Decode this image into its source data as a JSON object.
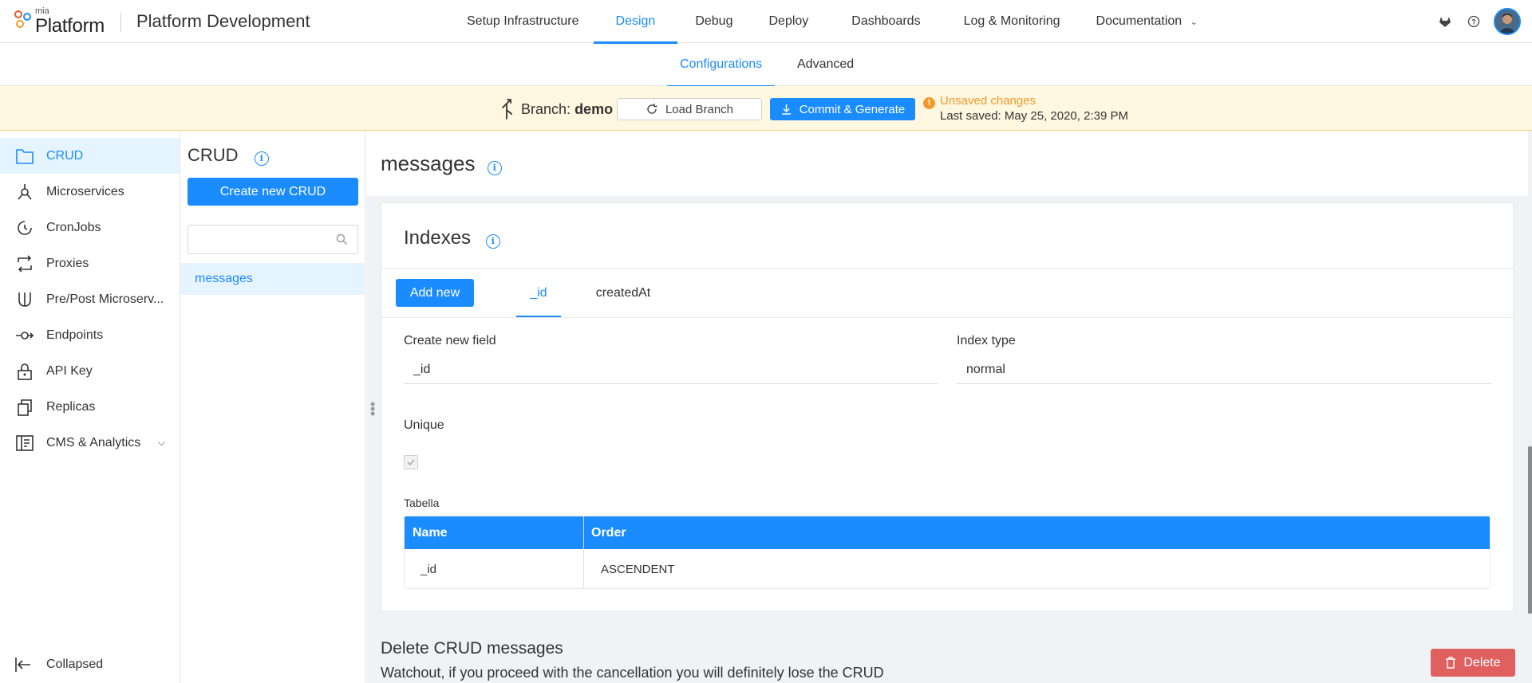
{
  "header": {
    "logo_small": "mia",
    "logo_big": "Platform",
    "app_title": "Platform Development",
    "nav": [
      {
        "label": "Setup Infrastructure"
      },
      {
        "label": "Design"
      },
      {
        "label": "Debug"
      },
      {
        "label": "Deploy"
      },
      {
        "label": "Dashboards"
      },
      {
        "label": "Log & Monitoring"
      },
      {
        "label": "Documentation"
      }
    ],
    "active_nav": "Design"
  },
  "subtabs": [
    {
      "label": "Configurations"
    },
    {
      "label": "Advanced"
    }
  ],
  "branch": {
    "label": "Branch:",
    "name": "demo",
    "load_button": "Load Branch",
    "commit_button": "Commit & Generate",
    "unsaved": "Unsaved changes",
    "last_saved": "Last saved:  May 25, 2020, 2:39 PM"
  },
  "sidebar": {
    "items": [
      {
        "label": "CRUD",
        "icon": "folder-icon"
      },
      {
        "label": "Microservices",
        "icon": "microservices-icon"
      },
      {
        "label": "CronJobs",
        "icon": "clock-icon"
      },
      {
        "label": "Proxies",
        "icon": "swap-icon"
      },
      {
        "label": "Pre/Post Microserv...",
        "icon": "fork-icon"
      },
      {
        "label": "Endpoints",
        "icon": "endpoint-icon"
      },
      {
        "label": "API Key",
        "icon": "lock-icon"
      },
      {
        "label": "Replicas",
        "icon": "copy-icon"
      },
      {
        "label": "CMS & Analytics",
        "icon": "cms-icon"
      }
    ],
    "collapsed_label": "Collapsed"
  },
  "crud_panel": {
    "title": "CRUD",
    "create_button": "Create new CRUD",
    "search_placeholder": "",
    "items": [
      "messages"
    ]
  },
  "main": {
    "title": "messages",
    "indexes": {
      "title": "Indexes",
      "add_button": "Add new",
      "tabs": [
        "_id",
        "createdAt"
      ],
      "field_label": "Create new field",
      "field_value": "_id",
      "type_label": "Index type",
      "type_value": "normal",
      "unique_label": "Unique",
      "table_label": "Tabella",
      "table_headers": [
        "Name",
        "Order"
      ],
      "table_rows": [
        [
          "_id",
          "ASCENDENT"
        ]
      ]
    },
    "delete": {
      "title": "Delete CRUD messages",
      "description": "Watchout, if you proceed with the cancellation you will definitely lose the CRUD",
      "button": "Delete"
    }
  },
  "colors": {
    "accent": "#1a8cff",
    "warning_bg": "#fff7e0",
    "warning": "#f19a2a",
    "danger": "#e06060"
  }
}
